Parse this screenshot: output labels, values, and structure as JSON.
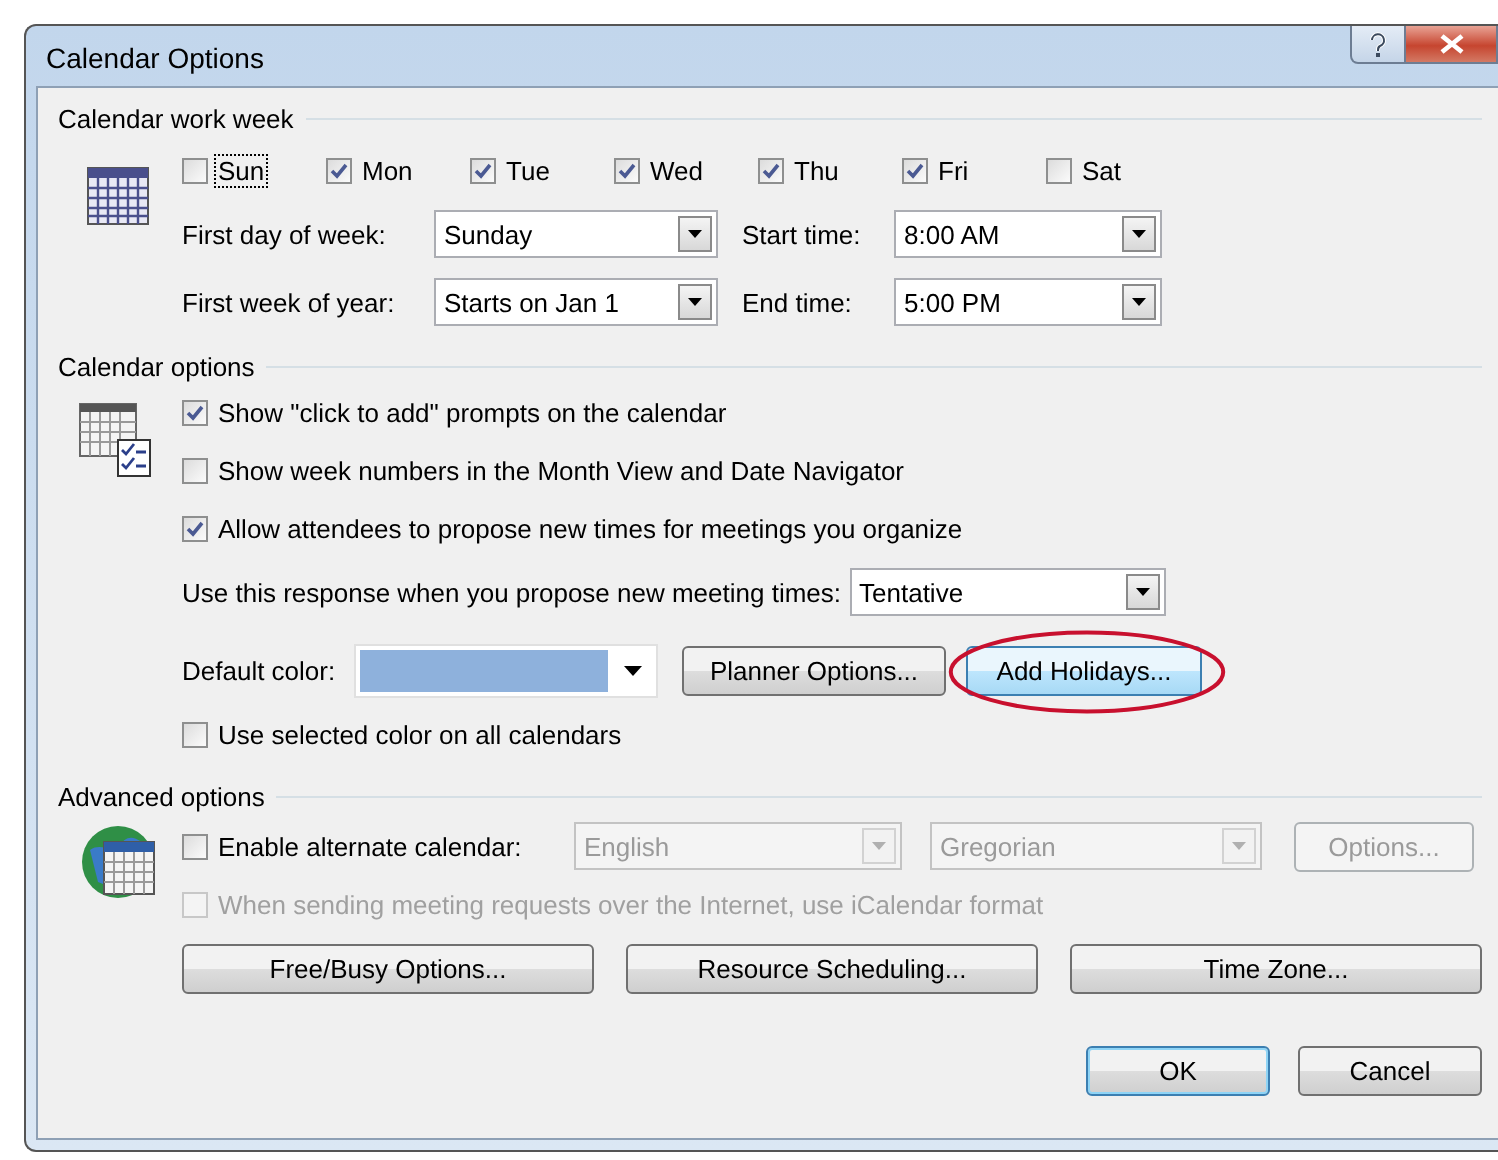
{
  "window": {
    "title": "Calendar Options"
  },
  "work_week": {
    "title": "Calendar work week",
    "days": [
      {
        "label": "Sun",
        "checked": false,
        "focused": true
      },
      {
        "label": "Mon",
        "checked": true,
        "focused": false
      },
      {
        "label": "Tue",
        "checked": true,
        "focused": false
      },
      {
        "label": "Wed",
        "checked": true,
        "focused": false
      },
      {
        "label": "Thu",
        "checked": true,
        "focused": false
      },
      {
        "label": "Fri",
        "checked": true,
        "focused": false
      },
      {
        "label": "Sat",
        "checked": false,
        "focused": false
      }
    ],
    "fields": [
      {
        "label": "First day of week:",
        "value": "Sunday"
      },
      {
        "label": "Start time:",
        "value": "8:00 AM"
      },
      {
        "label": "First week of year:",
        "value": "Starts on Jan 1"
      },
      {
        "label": "End time:",
        "value": "5:00 PM"
      }
    ]
  },
  "calendar_options": {
    "title": "Calendar options",
    "options": [
      {
        "label": "Show \"click to add\" prompts on the calendar",
        "checked": true
      },
      {
        "label": "Show week numbers in the Month View and Date Navigator",
        "checked": false
      },
      {
        "label": "Allow attendees to propose new times for meetings you organize",
        "checked": true
      }
    ],
    "response": {
      "label": "Use this response when you propose new meeting times:",
      "value": "Tentative"
    },
    "default_color": {
      "label": "Default color:",
      "color": "#8eb1dc"
    },
    "buttons": [
      {
        "label": "Planner Options...",
        "circled": false,
        "hover": false
      },
      {
        "label": "Add Holidays...",
        "circled": true,
        "hover": true
      }
    ],
    "use_selected_color": {
      "label": "Use selected color on all calendars",
      "checked": false
    }
  },
  "advanced_options": {
    "title": "Advanced options",
    "alternate_calendar": {
      "label": "Enable alternate calendar:",
      "checked": false,
      "language": "English",
      "calendar": "Gregorian",
      "options_button": "Options...",
      "disabled": true
    },
    "icalendar": {
      "label": "When sending meeting requests over the Internet, use iCalendar format",
      "checked": false,
      "disabled": true
    },
    "buttons": [
      "Free/Busy Options...",
      "Resource Scheduling...",
      "Time Zone..."
    ]
  },
  "footer_buttons": [
    {
      "label": "OK",
      "default": true
    },
    {
      "label": "Cancel",
      "default": false
    }
  ]
}
